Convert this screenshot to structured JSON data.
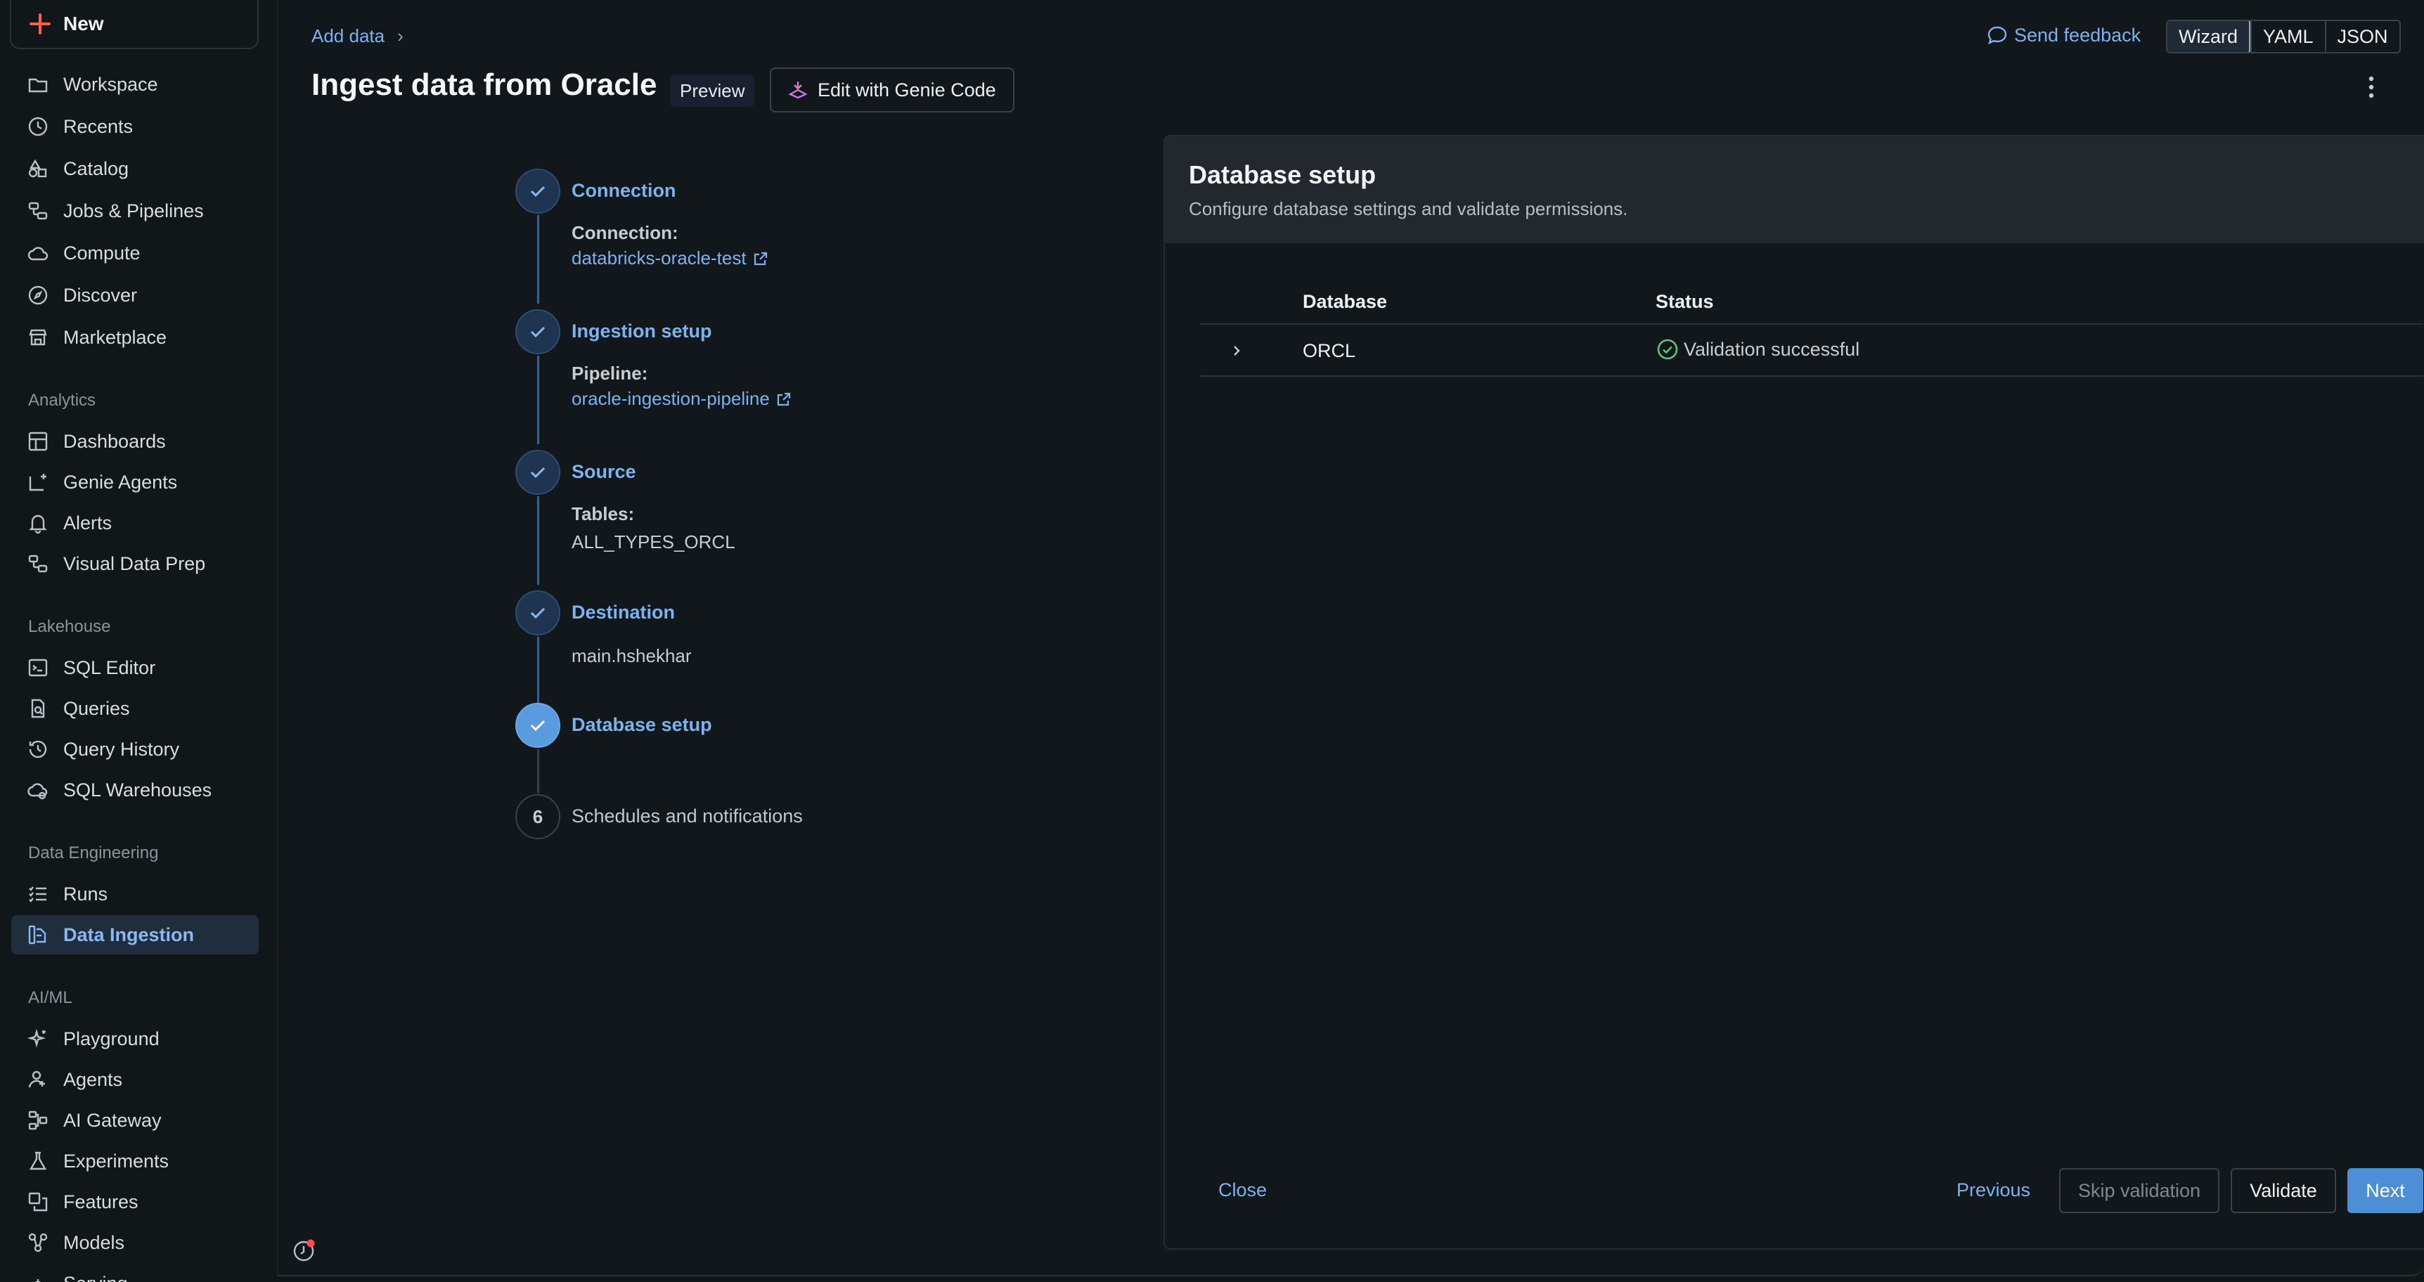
{
  "sidebar": {
    "new_label": "New",
    "items_top": [
      {
        "label": "Workspace",
        "icon": "workspace-icon"
      },
      {
        "label": "Recents",
        "icon": "clock-icon"
      },
      {
        "label": "Catalog",
        "icon": "catalog-icon"
      },
      {
        "label": "Jobs & Pipelines",
        "icon": "jobs-icon"
      },
      {
        "label": "Compute",
        "icon": "cloud-icon"
      },
      {
        "label": "Discover",
        "icon": "compass-icon"
      },
      {
        "label": "Marketplace",
        "icon": "store-icon"
      }
    ],
    "sections": {
      "analytics": "Analytics",
      "lakehouse": "Lakehouse",
      "data_engineering": "Data Engineering",
      "aiml": "AI/ML"
    },
    "analytics_items": [
      "Dashboards",
      "Genie Agents",
      "Alerts",
      "Visual Data Prep"
    ],
    "lakehouse_items": [
      "SQL Editor",
      "Queries",
      "Query History",
      "SQL Warehouses"
    ],
    "data_engineering_items": [
      "Runs",
      "Data Ingestion"
    ],
    "aiml_items": [
      "Playground",
      "Agents",
      "AI Gateway",
      "Experiments",
      "Features",
      "Models",
      "Serving"
    ],
    "active_item": "Data Ingestion"
  },
  "header": {
    "breadcrumb": "Add data",
    "title": "Ingest data from Oracle",
    "preview_tag": "Preview",
    "genie_button": "Edit with Genie Code",
    "feedback": "Send feedback",
    "modes": [
      "Wizard",
      "YAML",
      "JSON"
    ],
    "active_mode": "Wizard"
  },
  "steps": {
    "connection": {
      "title": "Connection",
      "sub": "Connection:",
      "link": "databricks-oracle-test"
    },
    "ingestion": {
      "title": "Ingestion setup",
      "sub": "Pipeline:",
      "link": "oracle-ingestion-pipeline"
    },
    "source": {
      "title": "Source",
      "sub": "Tables:",
      "value": "ALL_TYPES_ORCL"
    },
    "destination": {
      "title": "Destination",
      "value": "main.hshekhar"
    },
    "database": {
      "title": "Database setup"
    },
    "schedules": {
      "number": "6",
      "title": "Schedules and notifications"
    }
  },
  "card": {
    "title": "Database setup",
    "description": "Configure database settings and validate permissions.",
    "table": {
      "headers": [
        "Database",
        "Status"
      ],
      "rows": [
        {
          "database": "ORCL",
          "status": "Validation successful"
        }
      ]
    },
    "footer": {
      "close": "Close",
      "previous": "Previous",
      "skip": "Skip validation",
      "validate": "Validate",
      "next": "Next"
    }
  },
  "colors": {
    "accent": "#4d8fd6",
    "link": "#7cb2ee",
    "success": "#5cc37a",
    "brand_plus": "#ff5f46"
  }
}
